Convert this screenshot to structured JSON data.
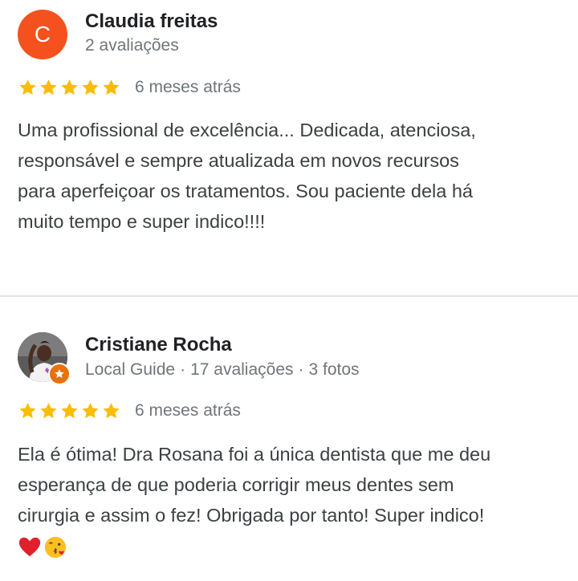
{
  "reviews": [
    {
      "avatar_letter": "C",
      "avatar_color": "#f4511e",
      "name": "Claudia freitas",
      "meta": {
        "reviews_count": "2 avaliações"
      },
      "rating": 5,
      "time": "6 meses atrás",
      "text_lines": [
        "Uma profissional de excelência... Dedicada, atenciosa,",
        "responsável e sempre atualizada em novos recursos",
        "para aperfeiçoar os tratamentos. Sou paciente dela há",
        "muito tempo e super indico!!!!"
      ]
    },
    {
      "avatar_icon": "user-photo",
      "name": "Cristiane Rocha",
      "meta": {
        "guide": "Local Guide",
        "sep": "·",
        "reviews_count": "17 avaliações",
        "photos": "3 fotos"
      },
      "rating": 5,
      "time": "6 meses atrás",
      "text_lines": [
        "Ela é ótima! Dra Rosana foi a única dentista que me deu",
        "esperança de que poderia corrigir meus dentes sem",
        "cirurgia e assim o fez! Obrigada por tanto! Super indico!"
      ],
      "emojis": [
        "red-heart-icon",
        "kissing-face-icon"
      ]
    }
  ],
  "colors": {
    "star": "#fbbc04",
    "meta_text": "#70757a",
    "body_text": "#3c4043",
    "divider": "#e3e3e3"
  }
}
